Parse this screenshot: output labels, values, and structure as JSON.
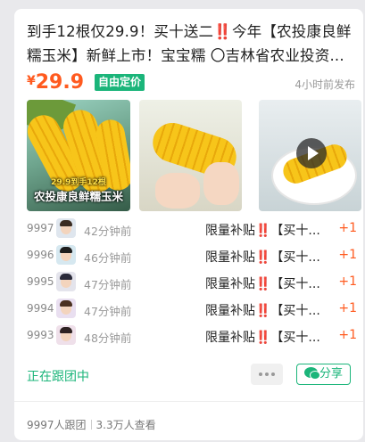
{
  "post": {
    "title": "到手12根仅29.9！买十送二‼️今年【农投康良鲜糯玉米】新鲜上市！宝宝糯 〇吉林省农业投资...",
    "currency": "¥",
    "price": "29.9",
    "badge": "自由定价",
    "posted": "4小时前发布"
  },
  "media": {
    "image1_caption_small": "29.9到手12根",
    "image1_caption": "农投康良鲜糯玉米",
    "icons": [
      "corn-image",
      "corn-image",
      "video-play-icon"
    ]
  },
  "orders": [
    {
      "no": "9997",
      "ago": "42分钟前",
      "msg": "限量补贴‼️【买十...",
      "qty": "+1"
    },
    {
      "no": "9996",
      "ago": "46分钟前",
      "msg": "限量补贴‼️【买十...",
      "qty": "+1"
    },
    {
      "no": "9995",
      "ago": "47分钟前",
      "msg": "限量补贴‼️【买十...",
      "qty": "+1"
    },
    {
      "no": "9994",
      "ago": "47分钟前",
      "msg": "限量补贴‼️【买十...",
      "qty": "+1"
    },
    {
      "no": "9993",
      "ago": "48分钟前",
      "msg": "限量补贴‼️【买十...",
      "qty": "+1"
    }
  ],
  "actions": {
    "status": "正在跟团中",
    "share": "分享"
  },
  "footer": {
    "followers": "9997人跟团",
    "views": "3.3万人查看"
  },
  "colors": {
    "accent_green": "#1bb57a",
    "price_orange": "#ff5a1f"
  }
}
